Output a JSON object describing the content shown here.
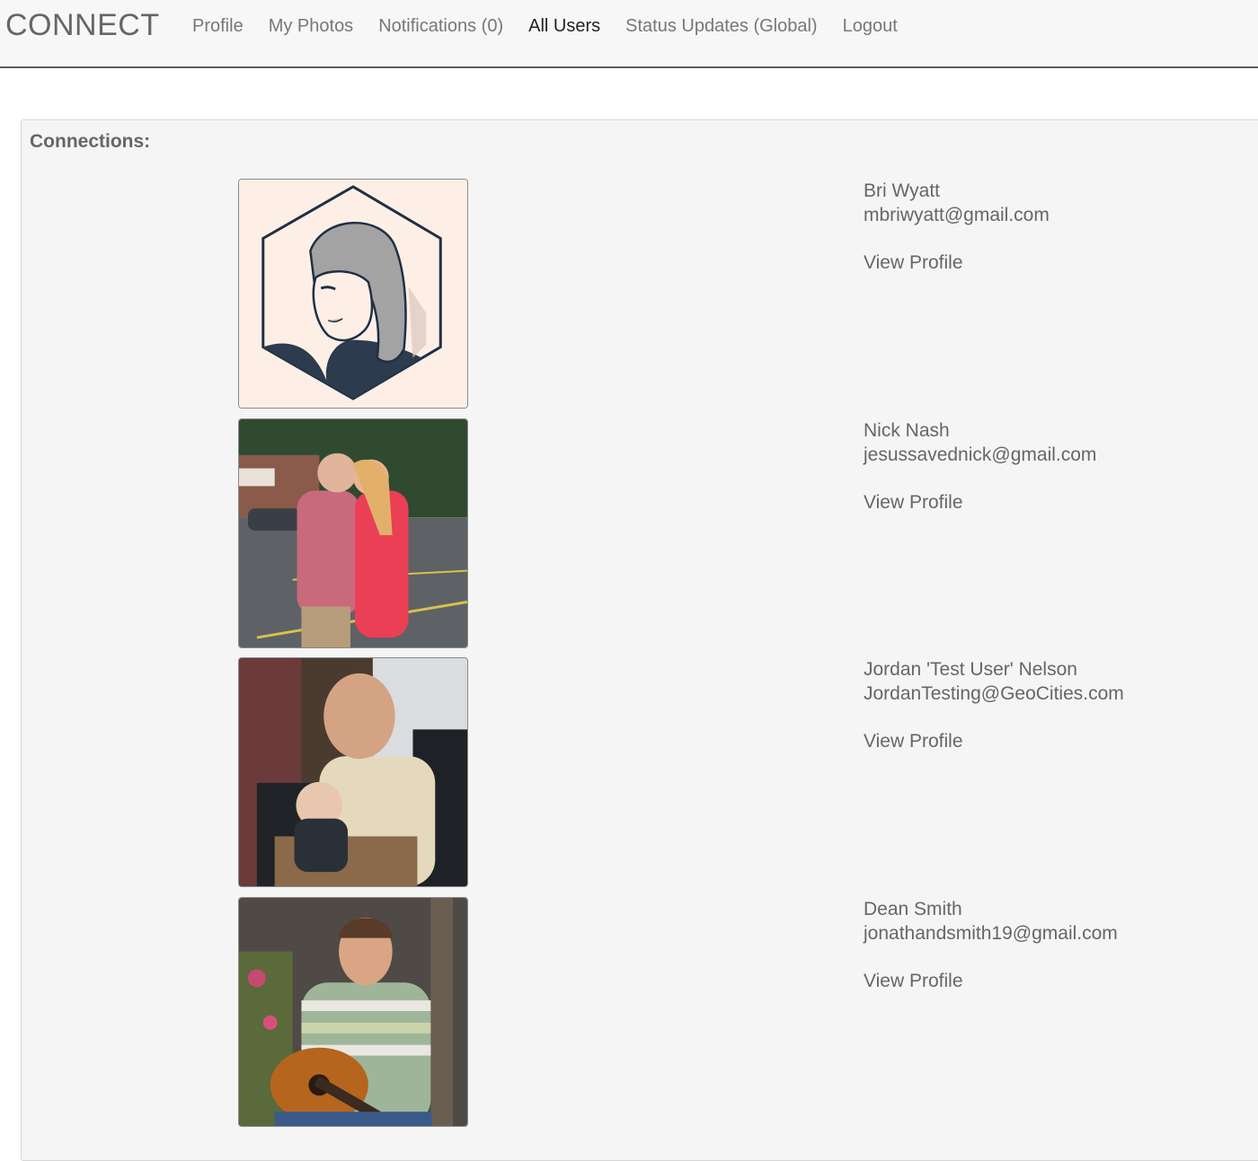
{
  "nav": {
    "brand": "CONNECT",
    "links": [
      "Profile",
      "My Photos",
      "Notifications (0)",
      "All Users",
      "Status Updates (Global)",
      "Logout"
    ]
  },
  "panel": {
    "title": "Connections:"
  },
  "connections": [
    {
      "name": "Bri Wyatt",
      "email": "mbriwyatt@gmail.com",
      "action": "View Profile"
    },
    {
      "name": "Nick Nash",
      "email": "jesussavednick@gmail.com",
      "action": "View Profile"
    },
    {
      "name": "Jordan 'Test User' Nelson",
      "email": "JordanTesting@GeoCities.com",
      "action": "View Profile"
    },
    {
      "name": "Dean Smith",
      "email": "jonathandsmith19@gmail.com",
      "action": "View Profile"
    }
  ]
}
